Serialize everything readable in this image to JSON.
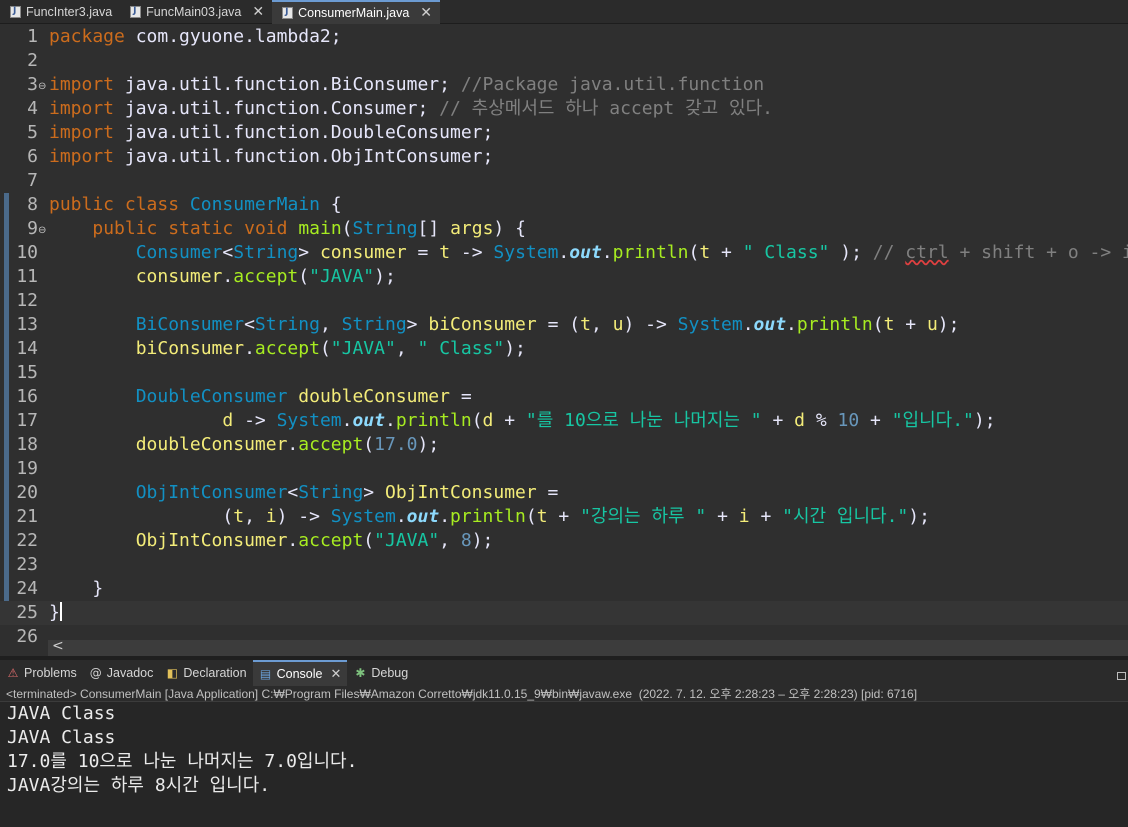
{
  "editor_tabs": [
    {
      "label": "FuncInter3.java",
      "active": false,
      "closable": false
    },
    {
      "label": "FuncMain03.java",
      "active": false,
      "closable": true
    },
    {
      "label": "ConsumerMain.java",
      "active": true,
      "closable": true
    }
  ],
  "code": {
    "current_line": 25,
    "lines": [
      {
        "n": "1",
        "fold": "",
        "tokens": [
          [
            "kw",
            "package"
          ],
          [
            "op",
            " com.gyuone.lambda2;"
          ]
        ]
      },
      {
        "n": "2",
        "fold": "",
        "tokens": []
      },
      {
        "n": "3",
        "fold": "⊖",
        "tokens": [
          [
            "kw",
            "import"
          ],
          [
            "op",
            " java.util.function.BiConsumer; "
          ],
          [
            "cm",
            "//Package java.util.function"
          ]
        ]
      },
      {
        "n": "4",
        "fold": "",
        "tokens": [
          [
            "kw",
            "import"
          ],
          [
            "op",
            " java.util.function.Consumer; "
          ],
          [
            "cm",
            "// 추상메서드 하나 accept 갖고 있다."
          ]
        ]
      },
      {
        "n": "5",
        "fold": "",
        "tokens": [
          [
            "kw",
            "import"
          ],
          [
            "op",
            " java.util.function.DoubleConsumer;"
          ]
        ]
      },
      {
        "n": "6",
        "fold": "",
        "tokens": [
          [
            "kw",
            "import"
          ],
          [
            "op",
            " java.util.function.ObjIntConsumer;"
          ]
        ]
      },
      {
        "n": "7",
        "fold": "",
        "tokens": []
      },
      {
        "n": "8",
        "fold": "",
        "tokens": [
          [
            "kw",
            "public"
          ],
          [
            "op",
            " "
          ],
          [
            "kw",
            "class"
          ],
          [
            "op",
            " "
          ],
          [
            "ty",
            "ConsumerMain"
          ],
          [
            "op",
            " {"
          ]
        ]
      },
      {
        "n": "9",
        "fold": "⊖",
        "tokens": [
          [
            "op",
            "    "
          ],
          [
            "kw",
            "public"
          ],
          [
            "op",
            " "
          ],
          [
            "kw",
            "static"
          ],
          [
            "op",
            " "
          ],
          [
            "kw",
            "void"
          ],
          [
            "op",
            " "
          ],
          [
            "mt",
            "main"
          ],
          [
            "op",
            "("
          ],
          [
            "ty",
            "String"
          ],
          [
            "op",
            "[] "
          ],
          [
            "vr",
            "args"
          ],
          [
            "op",
            ") {"
          ]
        ]
      },
      {
        "n": "10",
        "fold": "",
        "tokens": [
          [
            "op",
            "        "
          ],
          [
            "ty",
            "Consumer"
          ],
          [
            "op",
            "<"
          ],
          [
            "ty",
            "String"
          ],
          [
            "op",
            "> "
          ],
          [
            "vr",
            "consumer"
          ],
          [
            "op",
            " = "
          ],
          [
            "vr",
            "t"
          ],
          [
            "op",
            " -> "
          ],
          [
            "ty",
            "System"
          ],
          [
            "op",
            "."
          ],
          [
            "sf",
            "out"
          ],
          [
            "op",
            "."
          ],
          [
            "mt",
            "println"
          ],
          [
            "op",
            "("
          ],
          [
            "vr",
            "t"
          ],
          [
            "op",
            " + "
          ],
          [
            "st",
            "\" Class\""
          ],
          [
            "op",
            " ); "
          ],
          [
            "cm",
            "// "
          ],
          [
            "cm sq",
            "ctrl"
          ],
          [
            "cm",
            " + shift + o -> import"
          ]
        ]
      },
      {
        "n": "11",
        "fold": "",
        "tokens": [
          [
            "op",
            "        "
          ],
          [
            "vr",
            "consumer"
          ],
          [
            "op",
            "."
          ],
          [
            "mt",
            "accept"
          ],
          [
            "op",
            "("
          ],
          [
            "st",
            "\"JAVA\""
          ],
          [
            "op",
            ");"
          ]
        ]
      },
      {
        "n": "12",
        "fold": "",
        "tokens": []
      },
      {
        "n": "13",
        "fold": "",
        "tokens": [
          [
            "op",
            "        "
          ],
          [
            "ty",
            "BiConsumer"
          ],
          [
            "op",
            "<"
          ],
          [
            "ty",
            "String"
          ],
          [
            "op",
            ", "
          ],
          [
            "ty",
            "String"
          ],
          [
            "op",
            "> "
          ],
          [
            "vr",
            "biConsumer"
          ],
          [
            "op",
            " = ("
          ],
          [
            "vr",
            "t"
          ],
          [
            "op",
            ", "
          ],
          [
            "vr",
            "u"
          ],
          [
            "op",
            ") -> "
          ],
          [
            "ty",
            "System"
          ],
          [
            "op",
            "."
          ],
          [
            "sf",
            "out"
          ],
          [
            "op",
            "."
          ],
          [
            "mt",
            "println"
          ],
          [
            "op",
            "("
          ],
          [
            "vr",
            "t"
          ],
          [
            "op",
            " + "
          ],
          [
            "vr",
            "u"
          ],
          [
            "op",
            ");"
          ]
        ]
      },
      {
        "n": "14",
        "fold": "",
        "tokens": [
          [
            "op",
            "        "
          ],
          [
            "vr",
            "biConsumer"
          ],
          [
            "op",
            "."
          ],
          [
            "mt",
            "accept"
          ],
          [
            "op",
            "("
          ],
          [
            "st",
            "\"JAVA\""
          ],
          [
            "op",
            ", "
          ],
          [
            "st",
            "\" Class\""
          ],
          [
            "op",
            ");"
          ]
        ]
      },
      {
        "n": "15",
        "fold": "",
        "tokens": []
      },
      {
        "n": "16",
        "fold": "",
        "tokens": [
          [
            "op",
            "        "
          ],
          [
            "ty",
            "DoubleConsumer"
          ],
          [
            "op",
            " "
          ],
          [
            "vr",
            "doubleConsumer"
          ],
          [
            "op",
            " ="
          ]
        ]
      },
      {
        "n": "17",
        "fold": "",
        "tokens": [
          [
            "op",
            "                "
          ],
          [
            "vr",
            "d"
          ],
          [
            "op",
            " -> "
          ],
          [
            "ty",
            "System"
          ],
          [
            "op",
            "."
          ],
          [
            "sf",
            "out"
          ],
          [
            "op",
            "."
          ],
          [
            "mt",
            "println"
          ],
          [
            "op",
            "("
          ],
          [
            "vr",
            "d"
          ],
          [
            "op",
            " + "
          ],
          [
            "st",
            "\"를 10으로 나눈 나머지는 \""
          ],
          [
            "op",
            " + "
          ],
          [
            "vr",
            "d"
          ],
          [
            "op",
            " % "
          ],
          [
            "nm",
            "10"
          ],
          [
            "op",
            " + "
          ],
          [
            "st",
            "\"입니다.\""
          ],
          [
            "op",
            ");"
          ]
        ]
      },
      {
        "n": "18",
        "fold": "",
        "tokens": [
          [
            "op",
            "        "
          ],
          [
            "vr",
            "doubleConsumer"
          ],
          [
            "op",
            "."
          ],
          [
            "mt",
            "accept"
          ],
          [
            "op",
            "("
          ],
          [
            "nm",
            "17.0"
          ],
          [
            "op",
            ");"
          ]
        ]
      },
      {
        "n": "19",
        "fold": "",
        "tokens": []
      },
      {
        "n": "20",
        "fold": "",
        "tokens": [
          [
            "op",
            "        "
          ],
          [
            "ty",
            "ObjIntConsumer"
          ],
          [
            "op",
            "<"
          ],
          [
            "ty",
            "String"
          ],
          [
            "op",
            "> "
          ],
          [
            "vr",
            "ObjIntConsumer"
          ],
          [
            "op",
            " ="
          ]
        ]
      },
      {
        "n": "21",
        "fold": "",
        "tokens": [
          [
            "op",
            "                ("
          ],
          [
            "vr",
            "t"
          ],
          [
            "op",
            ", "
          ],
          [
            "vr",
            "i"
          ],
          [
            "op",
            ") -> "
          ],
          [
            "ty",
            "System"
          ],
          [
            "op",
            "."
          ],
          [
            "sf",
            "out"
          ],
          [
            "op",
            "."
          ],
          [
            "mt",
            "println"
          ],
          [
            "op",
            "("
          ],
          [
            "vr",
            "t"
          ],
          [
            "op",
            " + "
          ],
          [
            "st",
            "\"강의는 하루 \""
          ],
          [
            "op",
            " + "
          ],
          [
            "vr",
            "i"
          ],
          [
            "op",
            " + "
          ],
          [
            "st",
            "\"시간 입니다.\""
          ],
          [
            "op",
            ");"
          ]
        ]
      },
      {
        "n": "22",
        "fold": "",
        "tokens": [
          [
            "op",
            "        "
          ],
          [
            "vr",
            "ObjIntConsumer"
          ],
          [
            "op",
            "."
          ],
          [
            "mt",
            "accept"
          ],
          [
            "op",
            "("
          ],
          [
            "st",
            "\"JAVA\""
          ],
          [
            "op",
            ", "
          ],
          [
            "nm",
            "8"
          ],
          [
            "op",
            ");"
          ]
        ]
      },
      {
        "n": "23",
        "fold": "",
        "tokens": []
      },
      {
        "n": "24",
        "fold": "",
        "tokens": [
          [
            "op",
            "    }"
          ]
        ]
      },
      {
        "n": "25",
        "fold": "",
        "tokens": [
          [
            "op",
            "}"
          ]
        ]
      },
      {
        "n": "26",
        "fold": "",
        "tokens": []
      }
    ]
  },
  "hscroll": {
    "left_arrow": "<"
  },
  "panel": {
    "tabs": [
      {
        "label": "Problems",
        "icon": "problems-icon",
        "glyph": "⚠",
        "color": "#e06c6c",
        "active": false
      },
      {
        "label": "Javadoc",
        "icon": "javadoc-icon",
        "glyph": "@",
        "color": "#d0d0d0",
        "active": false
      },
      {
        "label": "Declaration",
        "icon": "declaration-icon",
        "glyph": "◧",
        "color": "#e2c15a",
        "active": false
      },
      {
        "label": "Console",
        "icon": "console-icon",
        "glyph": "▤",
        "color": "#6aa0d8",
        "active": true
      },
      {
        "label": "Debug",
        "icon": "debug-icon",
        "glyph": "✱",
        "color": "#7ec27e",
        "active": false
      }
    ],
    "status": "<terminated> ConsumerMain [Java Application] C:₩Program Files₩Amazon Corretto₩jdk11.0.15_9₩bin₩javaw.exe  (2022. 7. 12. 오후 2:28:23 – 오후 2:28:23) [pid: 6716]",
    "output": [
      "JAVA Class",
      "JAVA Class",
      "17.0를 10으로 나눈 나머지는 7.0입니다.",
      "JAVA강의는 하루 8시간 입니다."
    ]
  },
  "colors": {
    "keyword": "#cc6c1d",
    "type": "#1290c3",
    "variable": "#f3ec79",
    "method": "#a7ec21",
    "string": "#17c6a3",
    "comment": "#808080",
    "static_field": "#8dd9fc",
    "number": "#6897bb",
    "active_tab_accent": "#6c9bd2"
  }
}
